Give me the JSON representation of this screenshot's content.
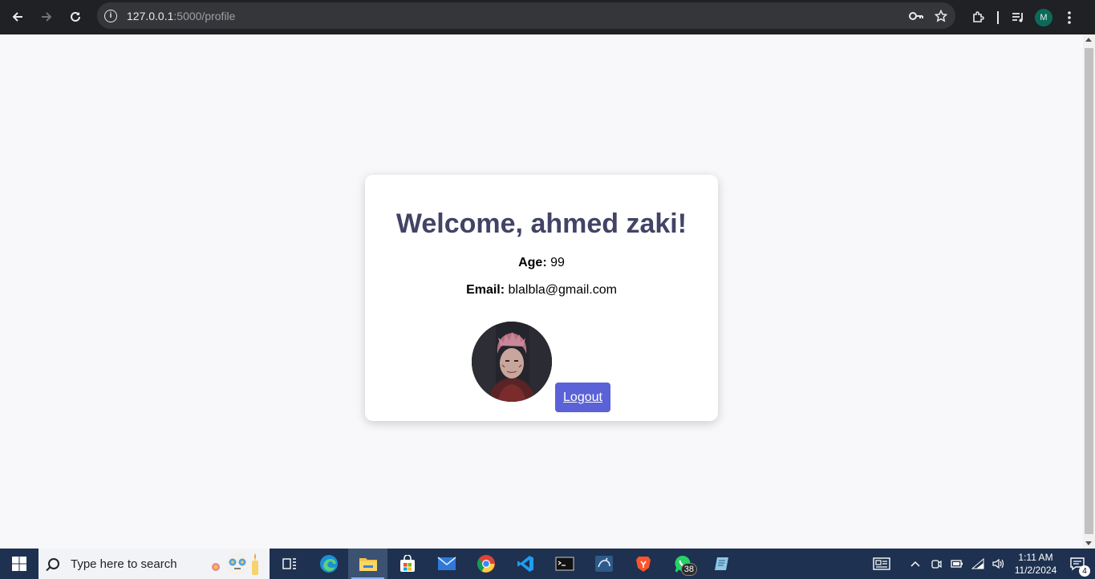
{
  "browser": {
    "url_host": "127.0.0.1",
    "url_rest": ":5000/profile",
    "profile_initial": "M"
  },
  "profile": {
    "welcome": "Welcome, ahmed zaki!",
    "age_label": "Age:",
    "age_value": "99",
    "email_label": "Email:",
    "email_value": "blalbla@gmail.com",
    "logout_label": "Logout"
  },
  "taskbar": {
    "search_placeholder": "Type here to search",
    "whatsapp_badge": "38",
    "time": "1:11 AM",
    "date": "11/2/2024",
    "notifications_count": "4"
  },
  "colors": {
    "heading": "#424366",
    "logout_button": "#5b61d6",
    "taskbar": "#1e3150"
  }
}
